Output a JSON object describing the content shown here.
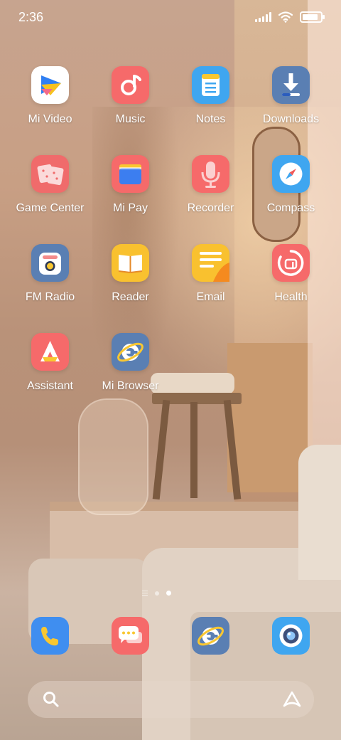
{
  "status": {
    "time": "2:36"
  },
  "apps": [
    {
      "label": "Mi Video",
      "icon": "mi-video-icon"
    },
    {
      "label": "Music",
      "icon": "music-icon"
    },
    {
      "label": "Notes",
      "icon": "notes-icon"
    },
    {
      "label": "Downloads",
      "icon": "downloads-icon"
    },
    {
      "label": "Game Center",
      "icon": "game-center-icon"
    },
    {
      "label": "Mi Pay",
      "icon": "mi-pay-icon"
    },
    {
      "label": "Recorder",
      "icon": "recorder-icon"
    },
    {
      "label": "Compass",
      "icon": "compass-icon"
    },
    {
      "label": "FM Radio",
      "icon": "fm-radio-icon"
    },
    {
      "label": "Reader",
      "icon": "reader-icon"
    },
    {
      "label": "Email",
      "icon": "email-icon"
    },
    {
      "label": "Health",
      "icon": "health-icon"
    },
    {
      "label": "Assistant",
      "icon": "assistant-icon"
    },
    {
      "label": "Mi Browser",
      "icon": "mi-browser-icon"
    }
  ],
  "dock": [
    {
      "icon": "phone-icon"
    },
    {
      "icon": "messaging-icon"
    },
    {
      "icon": "browser-icon"
    },
    {
      "icon": "camera-icon"
    }
  ],
  "pages": {
    "count": 2,
    "current": 2
  },
  "colors": {
    "label": "#ffffff",
    "music": "#f66a6a",
    "notes": "#3fa6f0",
    "downloads": "#5a7fb3"
  }
}
